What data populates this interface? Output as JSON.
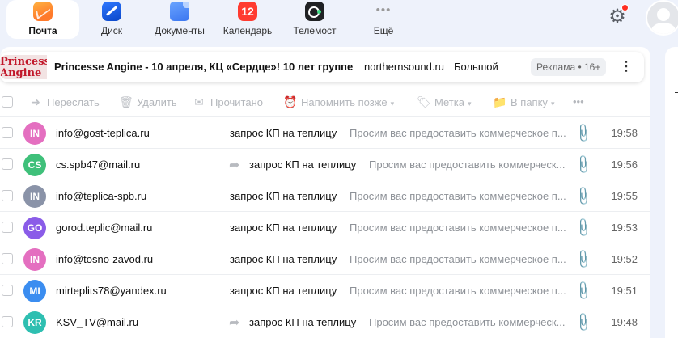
{
  "apps": [
    {
      "label": "Почта",
      "icon": "mail-icon",
      "active": true
    },
    {
      "label": "Диск",
      "icon": "disk-icon"
    },
    {
      "label": "Документы",
      "icon": "documents-icon"
    },
    {
      "label": "Календарь",
      "icon": "calendar-icon",
      "badge": "12"
    },
    {
      "label": "Телемост",
      "icon": "telemost-icon"
    },
    {
      "label": "Ещё",
      "icon": "more-icon",
      "glyph": "•••"
    }
  ],
  "ad": {
    "logo_text": [
      "Princesse",
      "Angine"
    ],
    "title": "Princesse Angine - 10 апреля, КЦ «Сердце»! 10 лет группе",
    "domain": "northernsound.ru",
    "extra": "Большой",
    "badge": "Реклама • 16+",
    "menu_glyph": "⋮"
  },
  "toolbar": [
    {
      "label": "Переслать",
      "icon": "forward-icon",
      "glyph": "➜"
    },
    {
      "label": "Удалить",
      "icon": "trash-icon",
      "glyph": "🗑"
    },
    {
      "label": "Прочитано",
      "icon": "envelope-open-icon",
      "glyph": "✉"
    },
    {
      "label": "Напомнить позже",
      "icon": "reminder-icon",
      "glyph": "⏰",
      "caret": "▾"
    },
    {
      "label": "Метка",
      "icon": "tag-icon",
      "glyph": "🏷",
      "caret": "▾"
    },
    {
      "label": "В папку",
      "icon": "folder-icon",
      "glyph": "📁",
      "caret": "▾"
    },
    {
      "label": "•••",
      "icon": "more-icon",
      "glyph": ""
    }
  ],
  "emails": [
    {
      "initials": "IN",
      "color": "#e46fc0",
      "sender": "info@gost-teplica.ru",
      "forwarded": false,
      "subject": "запрос КП на теплицу",
      "snippet": "Просим вас предоставить коммерческое п...",
      "time": "19:58"
    },
    {
      "initials": "CS",
      "color": "#3fc07a",
      "sender": "cs.spb47@mail.ru",
      "forwarded": true,
      "subject": "запрос КП на теплицу",
      "snippet": "Просим вас предоставить коммерческ...",
      "time": "19:56"
    },
    {
      "initials": "IN",
      "color": "#8a93a8",
      "sender": "info@teplica-spb.ru",
      "forwarded": false,
      "subject": "запрос КП на теплицу",
      "snippet": "Просим вас предоставить коммерческое п...",
      "time": "19:55"
    },
    {
      "initials": "GO",
      "color": "#8a5ce8",
      "sender": "gorod.teplic@mail.ru",
      "forwarded": false,
      "subject": "запрос КП на теплицу",
      "snippet": "Просим вас предоставить коммерческое п...",
      "time": "19:53"
    },
    {
      "initials": "IN",
      "color": "#e46fc0",
      "sender": "info@tosno-zavod.ru",
      "forwarded": false,
      "subject": "запрос КП на теплицу",
      "snippet": "Просим вас предоставить коммерческое п...",
      "time": "19:52"
    },
    {
      "initials": "MI",
      "color": "#3b8df0",
      "sender": "mirteplits78@yandex.ru",
      "forwarded": false,
      "subject": "запрос КП на теплицу",
      "snippet": "Просим вас предоставить коммерческое п...",
      "time": "19:51"
    },
    {
      "initials": "KR",
      "color": "#2ebfb1",
      "sender": "KSV_TV@mail.ru",
      "forwarded": true,
      "subject": "запрос КП на теплицу",
      "snippet": "Просим вас предоставить коммерческ...",
      "time": "19:48"
    }
  ]
}
